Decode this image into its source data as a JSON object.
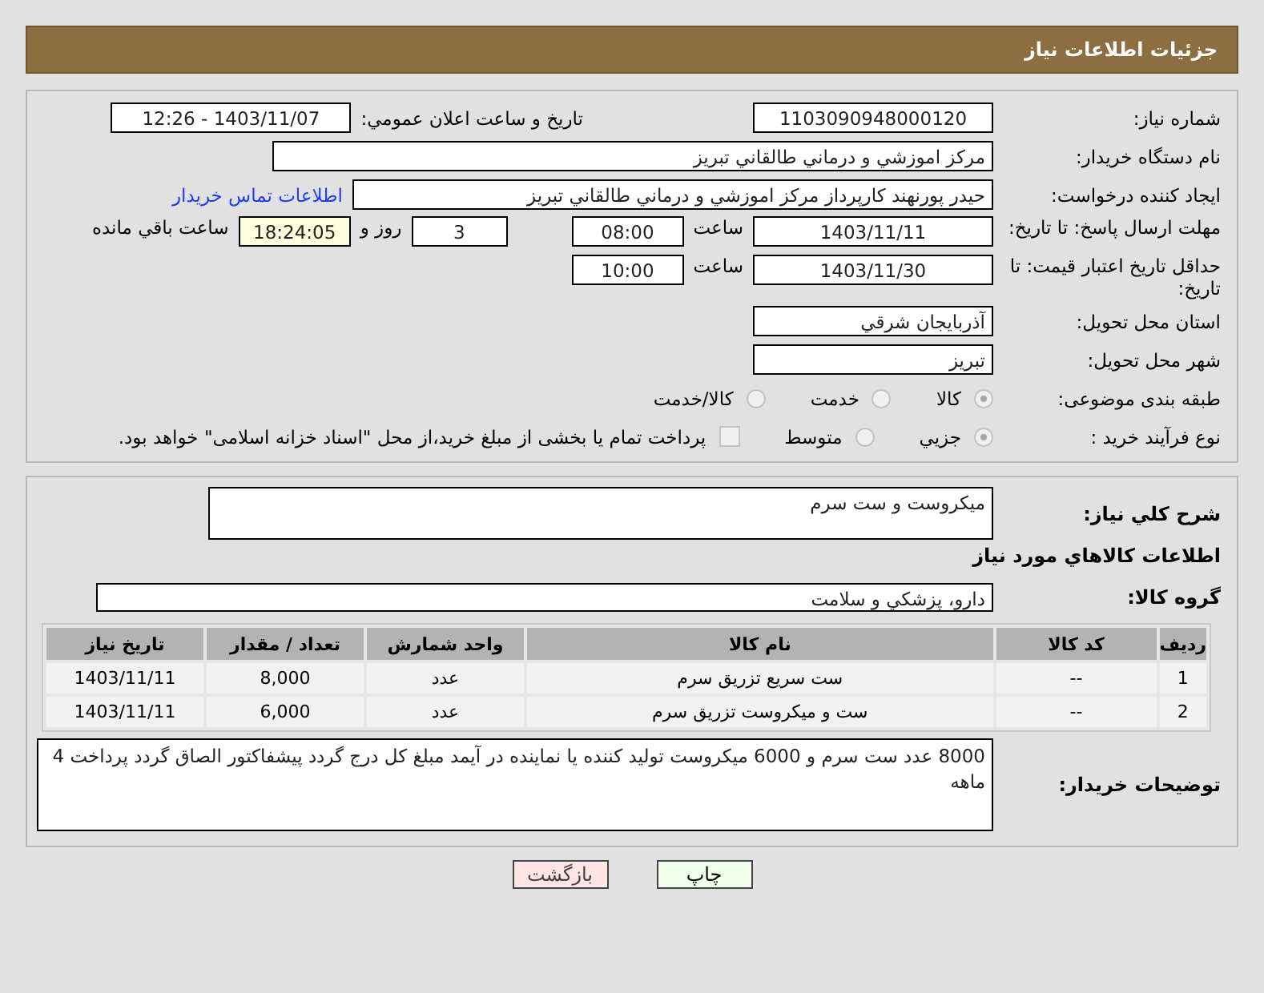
{
  "header": {
    "title": "جزئيات اطلاعات نياز"
  },
  "need_number": {
    "label": "شماره نياز:",
    "value": "1103090948000120"
  },
  "announce_date": {
    "label": "تاريخ و ساعت اعلان عمومي:",
    "value": "1403/11/07 - 12:26"
  },
  "buyer_org": {
    "label": "نام دستگاه خريدار:",
    "value": "مركز اموزشي و درماني طالقاني تبريز"
  },
  "requester": {
    "label": "ايجاد كننده درخواست:",
    "value": "حيدر پورنهند كارپرداز مركز اموزشي و درماني طالقاني تبريز",
    "link": "اطلاعات تماس خريدار"
  },
  "reply_deadline": {
    "label": "مهلت ارسال پاسخ: تا تاريخ:",
    "date": "1403/11/11",
    "time_label": "ساعت",
    "time": "08:00",
    "days": "3",
    "days_label": "روز و",
    "remaining": "18:24:05",
    "remaining_label": "ساعت باقي مانده"
  },
  "price_validity": {
    "label": "حداقل تاريخ اعتبار قيمت: تا تاريخ:",
    "date": "1403/11/30",
    "time_label": "ساعت",
    "time": "10:00"
  },
  "province": {
    "label": "استان محل تحويل:",
    "value": "آذربايجان شرقي"
  },
  "city": {
    "label": "شهر محل تحويل:",
    "value": "تبريز"
  },
  "category": {
    "label": "طبقه بندی موضوعی:",
    "options": [
      {
        "label": "كالا",
        "selected": true
      },
      {
        "label": "خدمت",
        "selected": false
      },
      {
        "label": "كالا/خدمت",
        "selected": false
      }
    ]
  },
  "purchase_type": {
    "label": "نوع فرآيند خريد :",
    "options": [
      {
        "label": "جزيي",
        "selected": true
      },
      {
        "label": "متوسط",
        "selected": false
      }
    ],
    "payment": {
      "label": "پرداخت تمام يا بخشی از مبلغ خريد،از محل \"اسناد خزانه اسلامی\" خواهد بود.",
      "checked": false
    }
  },
  "description": {
    "label": "شرح كلي نياز:",
    "value": "ميكروست و ست سرم"
  },
  "goods_heading": "اطلاعات كالاهاي مورد نياز",
  "goods_group": {
    "label": "گروه كالا:",
    "value": "دارو، پزشكي و سلامت"
  },
  "table": {
    "columns": [
      "رديف",
      "كد كالا",
      "نام كالا",
      "واحد شمارش",
      "تعداد / مقدار",
      "تاريخ نياز"
    ],
    "rows": [
      [
        "1",
        "--",
        "ست سريع تزريق سرم",
        "عدد",
        "8,000",
        "1403/11/11"
      ],
      [
        "2",
        "--",
        "ست و ميكروست تزريق سرم",
        "عدد",
        "6,000",
        "1403/11/11"
      ]
    ]
  },
  "buyer_notes": {
    "label": "توضيحات خريدار:",
    "value": "8000 عدد ست سرم و 6000 ميكروست توليد كننده يا نماينده در آيمد مبلغ كل درج گردد پيشفاكتور الصاق گردد پرداخت 4 ماهه"
  },
  "buttons": [
    {
      "label": "چاپ",
      "kind": "print"
    },
    {
      "label": "بازگشت",
      "kind": "back"
    }
  ]
}
